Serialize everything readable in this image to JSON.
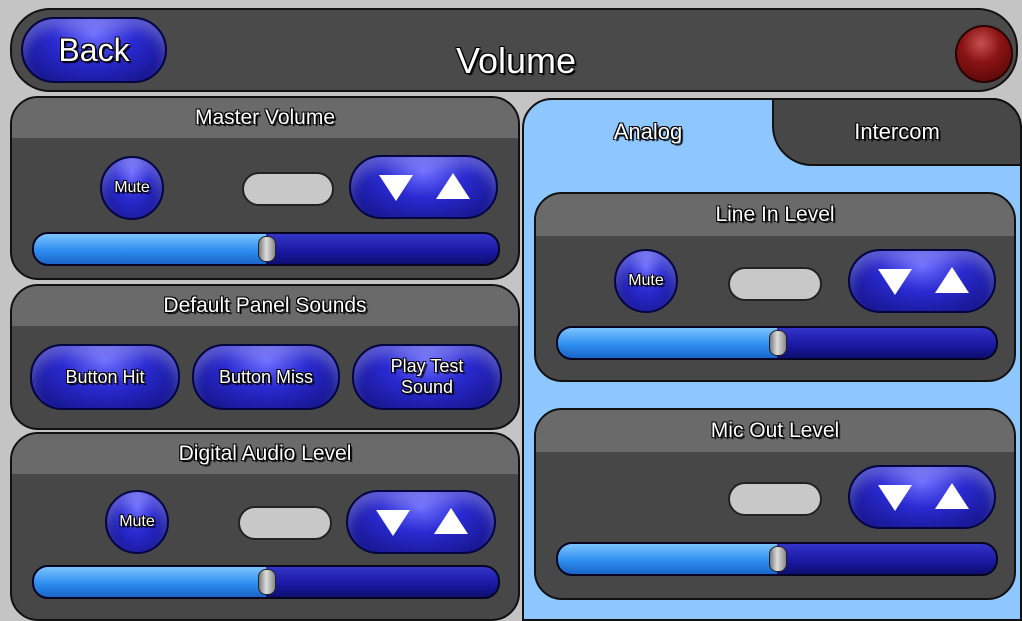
{
  "header": {
    "title": "Volume",
    "back_label": "Back"
  },
  "colors": {
    "button_blue": "#2a2ad2",
    "panel_dark": "#474747",
    "panel_header": "#6a6a6a",
    "tab_background": "#8ec6ff",
    "status_led": "#8a1414"
  },
  "master_volume": {
    "title": "Master Volume",
    "mute_label": "Mute",
    "level": 0.5
  },
  "panel_sounds": {
    "title": "Default Panel Sounds",
    "buttons": [
      "Button Hit",
      "Button Miss",
      "Play Test\nSound"
    ]
  },
  "digital_audio": {
    "title": "Digital Audio Level",
    "mute_label": "Mute",
    "level": 0.5
  },
  "tabs": {
    "active": "Analog",
    "items": [
      "Analog",
      "Intercom"
    ]
  },
  "line_in": {
    "title": "Line In Level",
    "mute_label": "Mute",
    "level": 0.5
  },
  "mic_out": {
    "title": "Mic Out Level",
    "level": 0.5
  },
  "icons": {
    "volume_down": "triangle-down",
    "volume_up": "triangle-up"
  }
}
